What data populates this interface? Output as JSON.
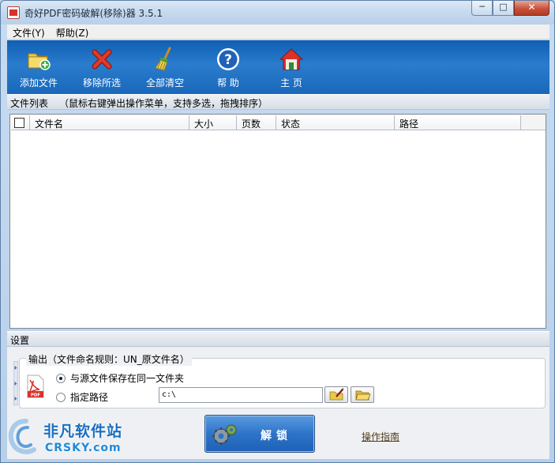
{
  "window": {
    "title": "奇好PDF密码破解(移除)器 3.5.1"
  },
  "window_controls": {
    "minimize": "─",
    "maximize": "□",
    "close": "✕"
  },
  "menu": [
    {
      "label": "文件(Y)"
    },
    {
      "label": "帮助(Z)"
    }
  ],
  "toolbar": [
    {
      "label": "添加文件",
      "icon": "add-folder-icon"
    },
    {
      "label": "移除所选",
      "icon": "remove-x-icon"
    },
    {
      "label": "全部清空",
      "icon": "broom-icon"
    },
    {
      "label": "帮 助",
      "icon": "help-icon"
    },
    {
      "label": "主 页",
      "icon": "home-icon"
    }
  ],
  "file_list": {
    "title": "文件列表",
    "hint": "（鼠标右键弹出操作菜单，支持多选，拖拽排序）",
    "columns": [
      "文件名",
      "大小",
      "页数",
      "状态",
      "路径"
    ],
    "rows": []
  },
  "settings": {
    "title": "设置",
    "output_legend": "输出（文件命名规则：UN_原文件名）",
    "option_same_folder": "与源文件保存在同一文件夹",
    "option_custom_path": "指定路径",
    "selected_option": "same_folder",
    "path_value": "c:\\"
  },
  "actions": {
    "unlock_label": "解锁",
    "guide_link": "操作指南"
  },
  "watermark": {
    "brand_cn": "非凡软件站",
    "brand_en": "CRSKY.com"
  }
}
